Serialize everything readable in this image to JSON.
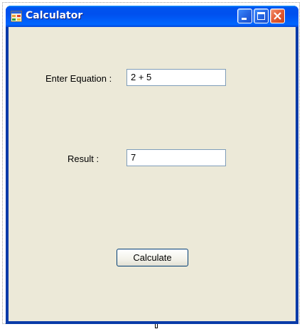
{
  "window": {
    "title": "Calculator",
    "icon": "form-icon"
  },
  "caption_buttons": {
    "minimize_icon": "minimize-icon",
    "maximize_icon": "maximize-icon",
    "close_icon": "close-icon"
  },
  "form": {
    "equation_label": "Enter Equation :",
    "equation_value": "2 + 5",
    "result_label": "Result :",
    "result_value": "7",
    "calculate_label": "Calculate"
  },
  "colors": {
    "titlebar": "#0053ee",
    "client_background": "#ece9d8",
    "close_button": "#e35a32"
  }
}
